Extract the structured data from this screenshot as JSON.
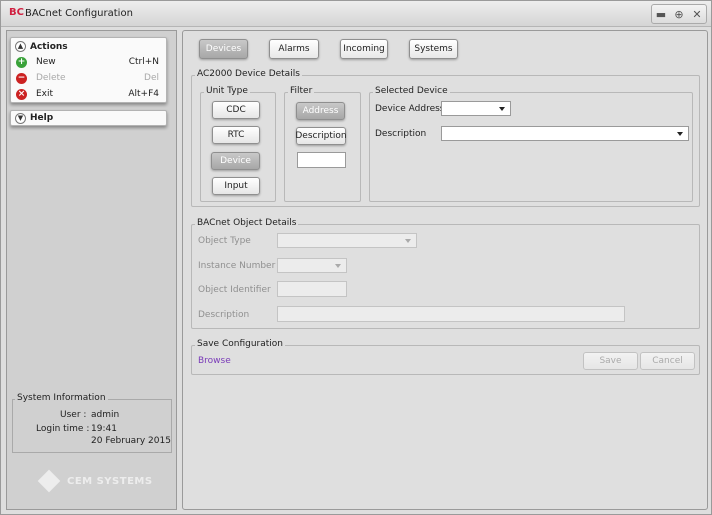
{
  "window": {
    "app_icon": "BC",
    "title": "BACnet Configuration"
  },
  "window_controls": [
    "minimize-icon",
    "zoom-icon",
    "close-icon"
  ],
  "actions_menu": {
    "title": "Actions",
    "items": [
      {
        "label": "New",
        "shortcut": "Ctrl+N",
        "icon": "add-icon",
        "color": "#3aa23a",
        "enabled": true
      },
      {
        "label": "Delete",
        "shortcut": "Del",
        "icon": "remove-icon",
        "color": "#cc2222",
        "enabled": false
      },
      {
        "label": "Exit",
        "shortcut": "Alt+F4",
        "icon": "exit-icon",
        "color": "#cc2222",
        "enabled": true
      }
    ]
  },
  "help_menu": {
    "title": "Help"
  },
  "system_info": {
    "title": "System Information",
    "user_label": "User :",
    "user_value": "admin",
    "login_label": "Login time :",
    "login_time": "19:41",
    "login_date": "20 February 2015"
  },
  "watermark": "CEM SYSTEMS",
  "tabs": [
    {
      "label": "Devices",
      "active": true
    },
    {
      "label": "Alarms",
      "active": false
    },
    {
      "label": "Incoming",
      "active": false
    },
    {
      "label": "Systems",
      "active": false
    }
  ],
  "device_details": {
    "title": "AC2000 Device Details",
    "unit_type": {
      "title": "Unit Type",
      "buttons": [
        {
          "label": "CDC",
          "active": false
        },
        {
          "label": "RTC",
          "active": false
        },
        {
          "label": "Device",
          "active": true
        },
        {
          "label": "Input",
          "active": false
        }
      ]
    },
    "filter": {
      "title": "Filter",
      "buttons": [
        {
          "label": "Address",
          "active": true
        },
        {
          "label": "Description",
          "active": false
        }
      ],
      "input_value": ""
    },
    "selected_device": {
      "title": "Selected Device",
      "address_label": "Device Address",
      "address_value": "",
      "description_label": "Description",
      "description_value": ""
    }
  },
  "object_details": {
    "title": "BACnet Object Details",
    "object_type_label": "Object Type",
    "object_type_value": "",
    "instance_number_label": "Instance Number",
    "instance_number_value": "",
    "object_identifier_label": "Object Identifier",
    "object_identifier_value": "",
    "description_label": "Description",
    "description_value": ""
  },
  "save_config": {
    "title": "Save Configuration",
    "browse_label": "Browse",
    "save_label": "Save",
    "cancel_label": "Cancel"
  }
}
